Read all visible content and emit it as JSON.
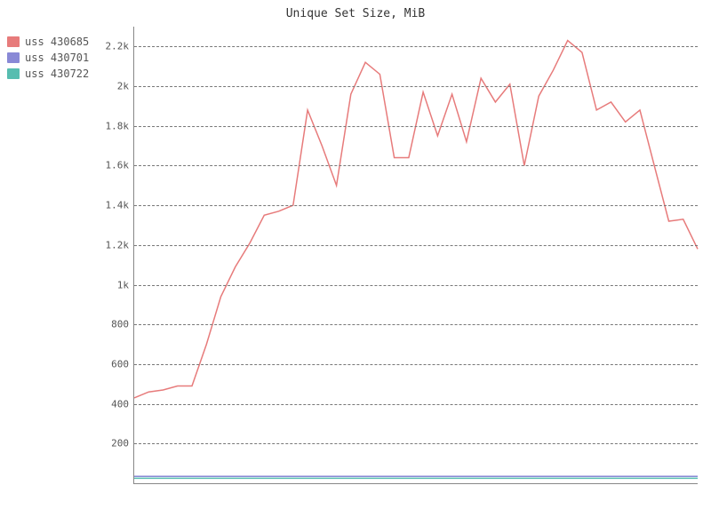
{
  "chart_data": {
    "type": "line",
    "title": "Unique Set Size, MiB",
    "xlabel": "",
    "ylabel": "",
    "ylim": [
      0,
      2300
    ],
    "x": [
      0,
      1,
      2,
      3,
      4,
      5,
      6,
      7,
      8,
      9,
      10,
      11,
      12,
      13,
      14,
      15,
      16,
      17,
      18,
      19,
      20,
      21,
      22,
      23,
      24,
      25,
      26,
      27,
      28,
      29,
      30,
      31,
      32,
      33,
      34,
      35,
      36,
      37,
      38,
      39
    ],
    "y_ticks": [
      200,
      400,
      600,
      800,
      1000,
      1200,
      1400,
      1600,
      1800,
      2000,
      2200
    ],
    "y_tick_labels": [
      "200",
      "400",
      "600",
      "800",
      "1k",
      "1.2k",
      "1.4k",
      "1.6k",
      "1.8k",
      "2k",
      "2.2k"
    ],
    "series": [
      {
        "name": "uss 430685",
        "color": "#e77b7b",
        "values": [
          430,
          460,
          470,
          490,
          490,
          700,
          940,
          1090,
          1210,
          1350,
          1370,
          1400,
          1880,
          1700,
          1500,
          1960,
          2120,
          2060,
          1640,
          1640,
          1970,
          1750,
          1960,
          1720,
          2040,
          1920,
          2010,
          1600,
          1950,
          2080,
          2230,
          2170,
          1880,
          1920,
          1820,
          1880,
          1600,
          1320,
          1330,
          1180
        ]
      },
      {
        "name": "uss 430701",
        "color": "#8989d6",
        "values": [
          35,
          35,
          35,
          35,
          35,
          35,
          35,
          35,
          35,
          35,
          35,
          35,
          35,
          35,
          35,
          35,
          35,
          35,
          35,
          35,
          35,
          35,
          35,
          35,
          35,
          35,
          35,
          35,
          35,
          35,
          35,
          35,
          35,
          35,
          35,
          35,
          35,
          35,
          35,
          35
        ]
      },
      {
        "name": "uss 430722",
        "color": "#57bdb0",
        "values": [
          25,
          25,
          25,
          25,
          25,
          25,
          25,
          25,
          25,
          25,
          25,
          25,
          25,
          25,
          25,
          25,
          25,
          25,
          25,
          25,
          25,
          25,
          25,
          25,
          25,
          25,
          25,
          25,
          25,
          25,
          25,
          25,
          25,
          25,
          25,
          25,
          25,
          25,
          25,
          25
        ]
      }
    ],
    "legend_position": "left"
  }
}
